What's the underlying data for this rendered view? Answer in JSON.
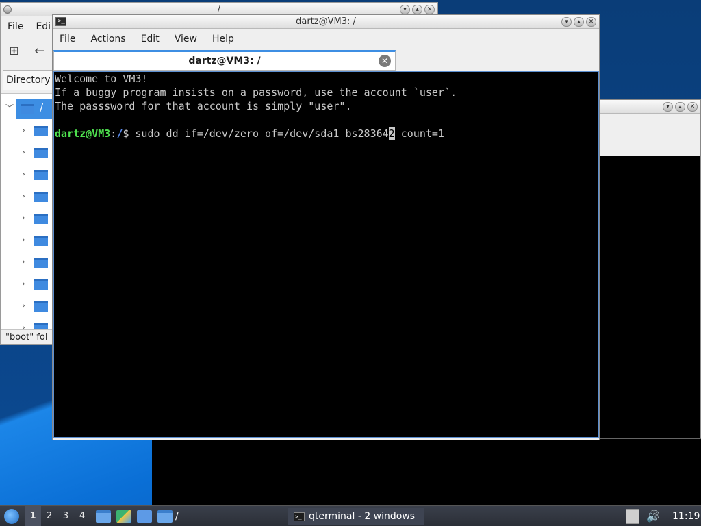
{
  "file_manager": {
    "title": "/",
    "menu": [
      "File",
      "Edi"
    ],
    "directory_tab": "Directory",
    "tree_root": "/",
    "status": "\"boot\" fol"
  },
  "terminal": {
    "title": "dartz@VM3: /",
    "menu": [
      "File",
      "Actions",
      "Edit",
      "View",
      "Help"
    ],
    "tab_label": "dartz@VM3: /",
    "lines": [
      "Welcome to VM3!",
      "If a buggy program insists on a password, use the account `user`.",
      "The passsword for that account is simply \"user\".",
      ""
    ],
    "prompt": {
      "user_host": "dartz@VM3",
      "sep": ":",
      "path": "/",
      "symbol": "$ ",
      "cmd_before_cursor": "sudo dd if=/dev/zero of=/dev/sda1 bs28364",
      "cursor_char": "2",
      "cmd_after_cursor": " count=1"
    }
  },
  "taskbar": {
    "desktops": [
      "1",
      "2",
      "3",
      "4"
    ],
    "path_label": "/",
    "task_label": "qterminal - 2 windows",
    "clock": "11:19"
  },
  "colors": {
    "prompt_user": "#4ee04e",
    "prompt_path": "#5b8df2",
    "accent": "#3d8ee3"
  }
}
